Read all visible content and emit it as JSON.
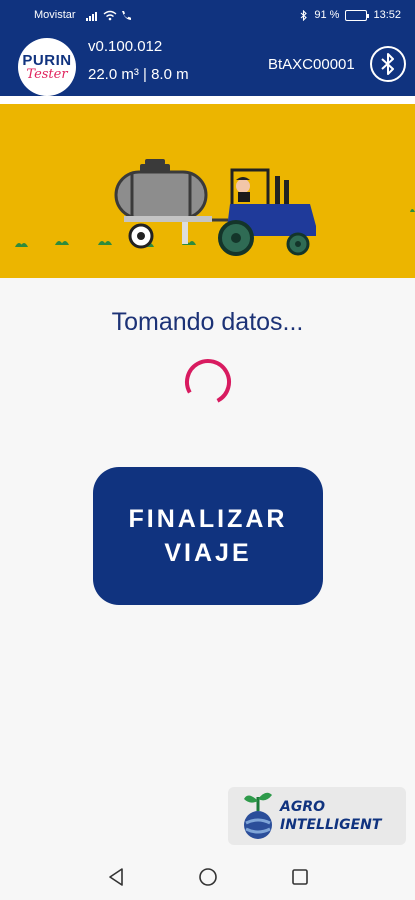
{
  "status_bar": {
    "carrier": "Movistar",
    "battery": "91 %",
    "time": "13:52"
  },
  "header": {
    "logo_top": "PURIN",
    "logo_bottom": "Tester",
    "version": "v0.100.012",
    "capacity": "22.0 m³ | 8.0 m",
    "device_id": "BtAXC00001",
    "bluetooth_icon": "bluetooth-icon"
  },
  "main": {
    "status_text": "Tomando datos...",
    "finish_button": "FINALIZAR\nVIAJE"
  },
  "footer": {
    "brand_line1": "AGRO",
    "brand_line2": "INTELLIGENT"
  },
  "colors": {
    "primary": "#10337f",
    "banner": "#ecb500",
    "spinner": "#d81b60"
  }
}
